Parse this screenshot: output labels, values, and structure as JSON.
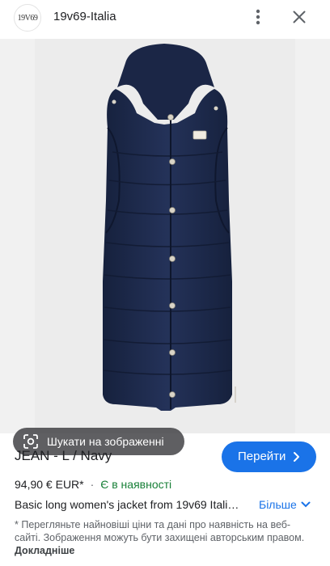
{
  "header": {
    "logo_text": "19V69",
    "site_name": "19v69-Italia"
  },
  "lens": {
    "label": "Шукати на зображенні"
  },
  "product": {
    "title": "JEAN - L / Navy",
    "goto_label": "Перейти",
    "price": "94,90 € EUR*",
    "separator": "·",
    "stock": "Є в наявності",
    "description": "Basic long women's jacket from 19v69 Itali…",
    "more_label": "Більше"
  },
  "disclaimer": {
    "text": "* Перегляньте найновіші ціни та дані про наявність на веб-сайті. Зображення можуть бути захищені авторським правом.",
    "link": "Докладніше"
  },
  "colors": {
    "accent": "#1a73e8",
    "in_stock": "#188038",
    "vest_navy": "#1f2c4d"
  }
}
